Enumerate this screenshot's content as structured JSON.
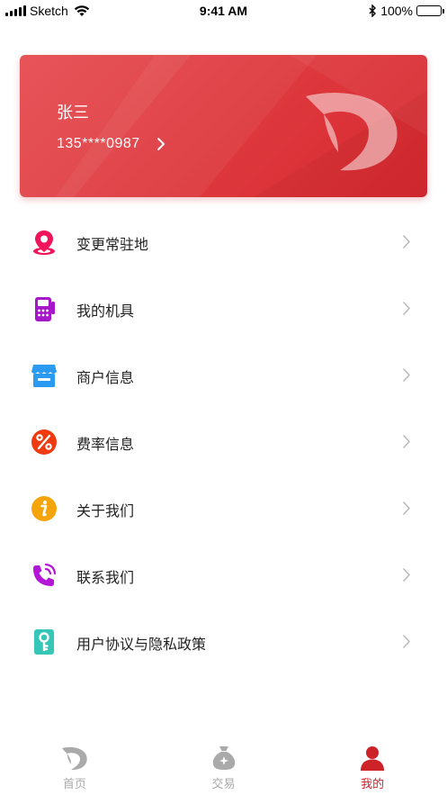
{
  "status_bar": {
    "carrier": "Sketch",
    "time": "9:41 AM",
    "battery": "100%",
    "battery_level": 1.0
  },
  "profile": {
    "name": "张三",
    "phone": "135****0987"
  },
  "menu": [
    {
      "label": "变更常驻地",
      "icon": "location-pin-icon",
      "color": "#f0145a"
    },
    {
      "label": "我的机具",
      "icon": "pos-terminal-icon",
      "color": "#a617c9"
    },
    {
      "label": "商户信息",
      "icon": "store-icon",
      "color": "#2a9bf0"
    },
    {
      "label": "费率信息",
      "icon": "percent-icon",
      "color": "#f03a10"
    },
    {
      "label": "关于我们",
      "icon": "info-icon",
      "color": "#f5a50a"
    },
    {
      "label": "联系我们",
      "icon": "phone-icon",
      "color": "#b316d6"
    },
    {
      "label": "用户协议与隐私政策",
      "icon": "key-icon",
      "color": "#35c6b8"
    }
  ],
  "tabbar": [
    {
      "label": "首页",
      "icon": "home-logo-icon",
      "active": false
    },
    {
      "label": "交易",
      "icon": "money-bag-icon",
      "active": false
    },
    {
      "label": "我的",
      "icon": "user-icon",
      "active": true
    }
  ],
  "colors": {
    "brand": "#cc2228",
    "card_gradient_start": "#e64a4f",
    "card_gradient_end": "#d7282e",
    "inactive_tab": "#aaaaaa"
  }
}
